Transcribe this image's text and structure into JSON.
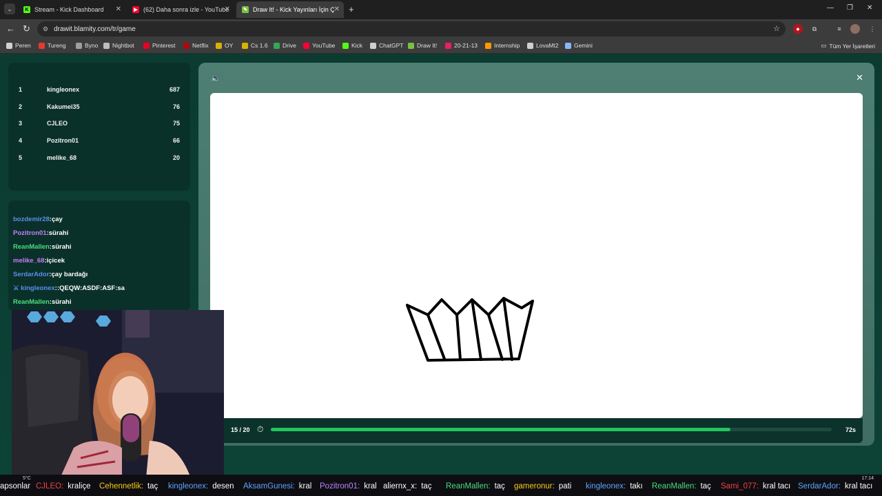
{
  "browser": {
    "tabs": [
      {
        "label": "Stream - Kick Dashboard",
        "color": "#53fc18",
        "glyph": "K"
      },
      {
        "label": "(62) Daha sonra izle - YouTube",
        "color": "#ff0033",
        "glyph": "▶"
      },
      {
        "label": "Draw It! - Kick Yayınları İçin Çiz",
        "color": "#7ac142",
        "glyph": "✎"
      }
    ],
    "url": "drawit.blamity.com/tr/game",
    "bookmarks": [
      {
        "label": "Peren",
        "color": "#cfcfcf"
      },
      {
        "label": "Tureng",
        "color": "#e53935"
      },
      {
        "label": "Byno",
        "color": "#9e9e9e"
      },
      {
        "label": "Nightbot",
        "color": "#bdbdbd"
      },
      {
        "label": "Pinterest",
        "color": "#e60023"
      },
      {
        "label": "Netflix",
        "color": "#b00710"
      },
      {
        "label": "OY",
        "color": "#d4b106"
      },
      {
        "label": "Cs 1.6",
        "color": "#d4b106"
      },
      {
        "label": "Drive",
        "color": "#34a853"
      },
      {
        "label": "YouTube",
        "color": "#ff0033"
      },
      {
        "label": "Kick",
        "color": "#53fc18"
      },
      {
        "label": "ChatGPT",
        "color": "#cfcfcf"
      },
      {
        "label": "Draw It!",
        "color": "#7ac142"
      },
      {
        "label": "20-21-13",
        "color": "#e91e63"
      },
      {
        "label": "Internship",
        "color": "#ff9800"
      },
      {
        "label": "LovaMt2",
        "color": "#cfcfcf"
      },
      {
        "label": "Gemini",
        "color": "#8ab4f8"
      }
    ],
    "all_bookmarks": "Tüm Yer İşaretleri"
  },
  "leaderboard": [
    {
      "rank": "1",
      "name": "kingleonex",
      "score": "687"
    },
    {
      "rank": "2",
      "name": "Kakumei35",
      "score": "76"
    },
    {
      "rank": "3",
      "name": "CJLEO",
      "score": "75"
    },
    {
      "rank": "4",
      "name": "Pozitron01",
      "score": "66"
    },
    {
      "rank": "5",
      "name": "melike_68",
      "score": "20"
    }
  ],
  "chat": [
    {
      "user": "bozdemir28",
      "text": "çay",
      "color": "#5b8def"
    },
    {
      "user": "Pozitron01",
      "text": "sürahi",
      "color": "#c77dff"
    },
    {
      "user": "ReanMallen",
      "text": "sürahi",
      "color": "#4ade80"
    },
    {
      "user": "melike_68",
      "text": "içicek",
      "color": "#c77dff"
    },
    {
      "user": "SerdarAdor",
      "text": "çay bardağı",
      "color": "#5b8def"
    },
    {
      "user": "kingleonex",
      "text": ":QEQW:ASDF:ASF:sa",
      "color": "#5b8def",
      "badge": true
    },
    {
      "user": "ReanMallen",
      "text": "sürahi",
      "color": "#4ade80"
    }
  ],
  "game": {
    "round": "15 / 20",
    "seconds_left": "72s",
    "progress": 0.82,
    "brush_color": "#000000"
  },
  "ticker": [
    {
      "user": "",
      "text": "apsonlar",
      "color": "#ffffff"
    },
    {
      "user": "CJLEO:",
      "text": "kraliçe",
      "color": "#ef4444"
    },
    {
      "user": "Cehennetlik:",
      "text": "taç",
      "color": "#facc15"
    },
    {
      "user": "kingleonex:",
      "text": "desen",
      "color": "#60a5fa"
    },
    {
      "user": "AksamGunesi:",
      "text": "kral",
      "color": "#60a5fa"
    },
    {
      "user": "Pozitron01:",
      "text": "kral",
      "color": "#c084fc"
    },
    {
      "user": "aliernx_x:",
      "text": "taç",
      "color": "#ffffff"
    },
    {
      "user": "ReanMallen:",
      "text": "taç",
      "color": "#4ade80"
    },
    {
      "user": "gameronur:",
      "text": "pati",
      "color": "#facc15"
    },
    {
      "user": "kingleonex:",
      "text": "takı",
      "color": "#60a5fa"
    },
    {
      "user": "ReanMallen:",
      "text": "taç",
      "color": "#4ade80"
    },
    {
      "user": "Sami_077:",
      "text": "kral tacı",
      "color": "#ef4444"
    },
    {
      "user": "SerdarAdor:",
      "text": "kral tacı",
      "color": "#60a5fa"
    }
  ],
  "weather": "5°C",
  "clock": "17:14"
}
